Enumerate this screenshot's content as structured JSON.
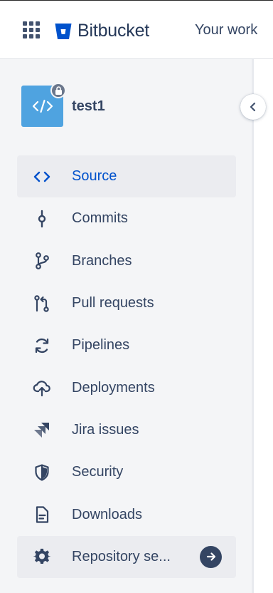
{
  "header": {
    "app_name": "Bitbucket",
    "your_work": "Your work"
  },
  "repository": {
    "name": "test1",
    "private": true
  },
  "sidebar": {
    "items": [
      {
        "label": "Source",
        "icon": "code-icon",
        "active": true
      },
      {
        "label": "Commits",
        "icon": "commit-icon",
        "active": false
      },
      {
        "label": "Branches",
        "icon": "branch-icon",
        "active": false
      },
      {
        "label": "Pull requests",
        "icon": "pull-request-icon",
        "active": false
      },
      {
        "label": "Pipelines",
        "icon": "refresh-icon",
        "active": false
      },
      {
        "label": "Deployments",
        "icon": "cloud-upload-icon",
        "active": false
      },
      {
        "label": "Jira issues",
        "icon": "jira-icon",
        "active": false
      },
      {
        "label": "Security",
        "icon": "shield-icon",
        "active": false
      },
      {
        "label": "Downloads",
        "icon": "document-icon",
        "active": false
      },
      {
        "label": "Repository se...",
        "icon": "gear-icon",
        "active": false
      }
    ]
  },
  "colors": {
    "accent": "#0052cc",
    "text": "#344563",
    "sidebar_bg": "#f4f5f7",
    "active_bg": "#ebecf0",
    "repo_avatar": "#4fa3e0"
  }
}
